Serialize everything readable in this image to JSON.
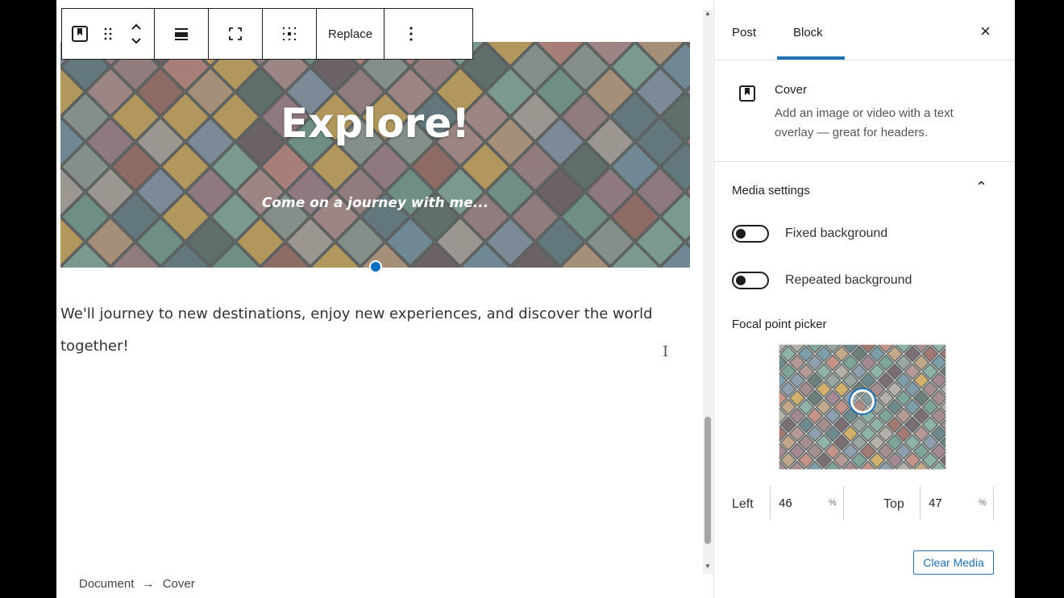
{
  "toolbar": {
    "replace_label": "Replace",
    "icons": [
      "cover-block-icon",
      "drag-handle-icon",
      "move-up-down-icon",
      "align-icon",
      "full-height-icon",
      "content-position-icon",
      "more-options-icon"
    ]
  },
  "cover": {
    "title": "Explore!",
    "subtitle": "Come on a journey with me..."
  },
  "paragraph": {
    "text": "We'll journey to new destinations, enjoy new experiences, and discover the world together!"
  },
  "breadcrumb": {
    "root": "Document",
    "arrow": "→",
    "current": "Cover"
  },
  "sidebar": {
    "tabs": [
      {
        "label": "Post",
        "active": false
      },
      {
        "label": "Block",
        "active": true
      }
    ],
    "close_glyph": "×",
    "block": {
      "title": "Cover",
      "description": "Add an image or video with a text overlay — great for headers."
    },
    "media_settings": {
      "title": "Media settings",
      "fixed_background": {
        "label": "Fixed background",
        "on": false
      },
      "repeated_background": {
        "label": "Repeated background",
        "on": false
      },
      "focal_label": "Focal point picker",
      "left_label": "Left",
      "left_value": "46",
      "top_label": "Top",
      "top_value": "47",
      "unit": "%",
      "clear_label": "Clear Media"
    }
  },
  "colors": {
    "accent": "#2271b1",
    "handle": "#0a6dc2"
  }
}
